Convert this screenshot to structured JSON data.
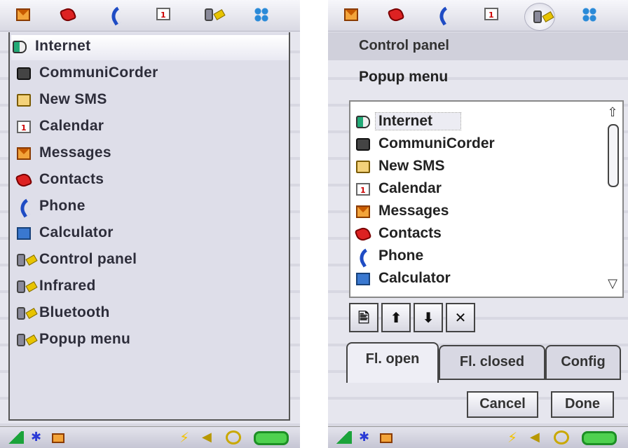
{
  "left_screen": {
    "menu_items": [
      {
        "label": "Internet",
        "icon": "internet-icon"
      },
      {
        "label": "CommuniCorder",
        "icon": "camera-icon"
      },
      {
        "label": "New SMS",
        "icon": "new-sms-icon"
      },
      {
        "label": "Calendar",
        "icon": "calendar-icon"
      },
      {
        "label": "Messages",
        "icon": "envelope-icon"
      },
      {
        "label": "Contacts",
        "icon": "contacts-book-icon"
      },
      {
        "label": "Phone",
        "icon": "phone-handset-icon"
      },
      {
        "label": "Calculator",
        "icon": "calculator-icon"
      },
      {
        "label": "Control panel",
        "icon": "control-panel-icon"
      },
      {
        "label": "Infrared",
        "icon": "control-panel-icon"
      },
      {
        "label": "Bluetooth",
        "icon": "control-panel-icon"
      },
      {
        "label": "Popup menu",
        "icon": "control-panel-icon"
      }
    ]
  },
  "top_bar_icons": [
    "envelope-icon",
    "contacts-book-icon",
    "phone-handset-icon",
    "calendar-icon",
    "control-panel-icon",
    "apps-grid-icon"
  ],
  "right_screen": {
    "title": "Control panel",
    "subtitle": "Popup menu",
    "list_items": [
      {
        "label": "Internet",
        "icon": "internet-icon"
      },
      {
        "label": "CommuniCorder",
        "icon": "camera-icon"
      },
      {
        "label": "New SMS",
        "icon": "new-sms-icon"
      },
      {
        "label": "Calendar",
        "icon": "calendar-icon"
      },
      {
        "label": "Messages",
        "icon": "envelope-icon"
      },
      {
        "label": "Contacts",
        "icon": "contacts-book-icon"
      },
      {
        "label": "Phone",
        "icon": "phone-handset-icon"
      },
      {
        "label": "Calculator",
        "icon": "calculator-icon"
      }
    ],
    "tool_buttons": {
      "add": "🖹",
      "up": "⬆",
      "down": "⬇",
      "delete": "✕"
    },
    "tabs": [
      "Fl. open",
      "Fl. closed",
      "Config"
    ],
    "cancel_label": "Cancel",
    "done_label": "Done"
  },
  "status_icons": [
    "signal-strength-icon",
    "bluetooth-icon",
    "envelope-icon",
    "charging-bolt-icon",
    "speaker-icon",
    "alarm-icon",
    "battery-icon"
  ],
  "colors": {
    "accent_blue": "#1f4cc4",
    "envelope_orange": "#f3a43a",
    "battery_green": "#4fd14f",
    "signal_green": "#1ba33a"
  }
}
